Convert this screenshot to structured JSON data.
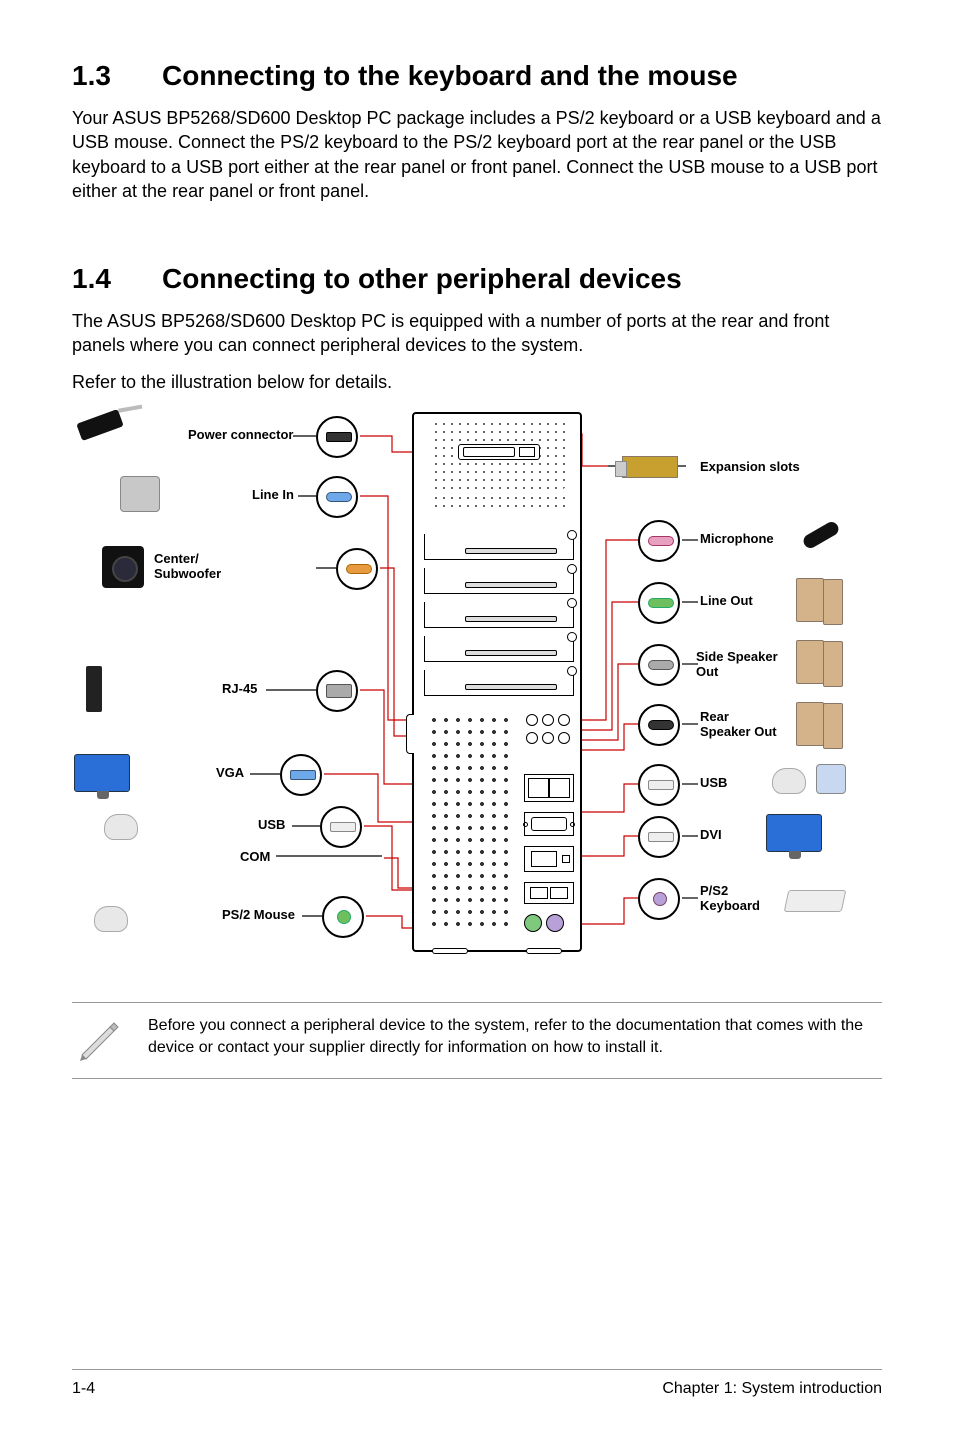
{
  "section13": {
    "num": "1.3",
    "title": "Connecting to the keyboard and the mouse",
    "body": "Your ASUS BP5268/SD600 Desktop PC package includes a PS/2 keyboard or a USB keyboard and a USB mouse. Connect the PS/2 keyboard to the PS/2 keyboard port at the rear panel or the USB keyboard to a USB port either at the rear panel or front panel. Connect the USB mouse to a USB port either at the rear panel or front panel."
  },
  "section14": {
    "num": "1.4",
    "title": "Connecting to other peripheral devices",
    "body1": "The ASUS BP5268/SD600 Desktop PC is equipped with a number of ports at the rear and front panels where you can connect peripheral devices to the system.",
    "body2": "Refer to the illustration below for details."
  },
  "diagram": {
    "left_labels": {
      "power": "Power connector",
      "line_in": "Line In",
      "center_sub": "Center/\nSubwoofer",
      "rj45": "RJ-45",
      "vga": "VGA",
      "usb": "USB",
      "com": "COM",
      "ps2_mouse": "PS/2 Mouse"
    },
    "right_labels": {
      "expansion": "Expansion slots",
      "microphone": "Microphone",
      "line_out": "Line Out",
      "side_spk": "Side Speaker\nOut",
      "rear_spk": "Rear\nSpeaker Out",
      "usb": "USB",
      "dvi": "DVI",
      "ps2_kb": "P/S2\nKeyboard"
    }
  },
  "note": "Before you connect a peripheral device to the system, refer to the documentation that comes with the device or contact your supplier directly for information on how to install it.",
  "footer": {
    "left": "1-4",
    "right": "Chapter 1: System introduction"
  }
}
